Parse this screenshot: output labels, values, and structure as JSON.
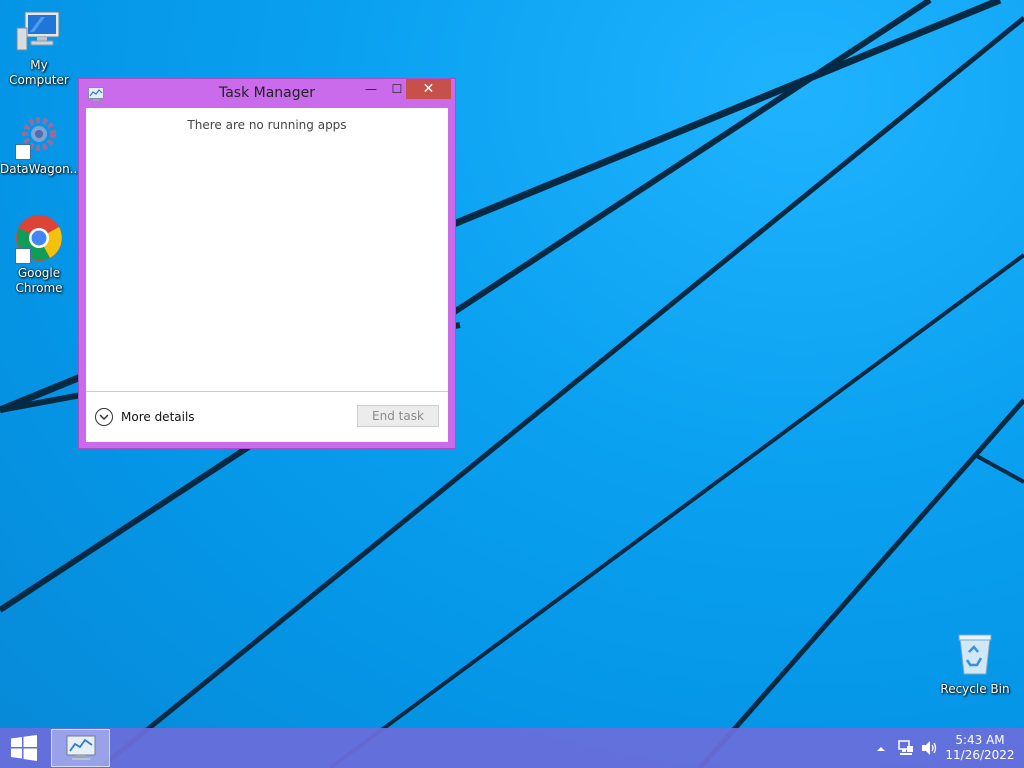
{
  "desktop": {
    "icons": [
      {
        "label": "My Computer",
        "icon": "computer-icon"
      },
      {
        "label": "DataWagon...",
        "icon": "gear-icon"
      },
      {
        "label": "Google Chrome",
        "icon": "chrome-icon"
      },
      {
        "label": "Recycle Bin",
        "icon": "recycle-bin-icon"
      }
    ]
  },
  "window": {
    "title": "Task Manager",
    "empty_message": "There are no running apps",
    "more_details_label": "More details",
    "end_task_label": "End task",
    "minimize_glyph": "—",
    "maximize_glyph": "☐",
    "close_glyph": "✕"
  },
  "taskbar": {
    "start_icon": "windows-logo-icon",
    "pinned": [
      {
        "name": "Task Manager",
        "icon": "task-manager-icon"
      }
    ],
    "tray": {
      "time": "5:43 AM",
      "date": "11/26/2022",
      "icons": [
        "chevron-up-icon",
        "network-icon",
        "volume-icon"
      ]
    }
  },
  "colors": {
    "window_frame": "#c96bea",
    "close_button": "#c7504a",
    "taskbar": "#6b6edc",
    "desktop": "#0aa1f0"
  }
}
